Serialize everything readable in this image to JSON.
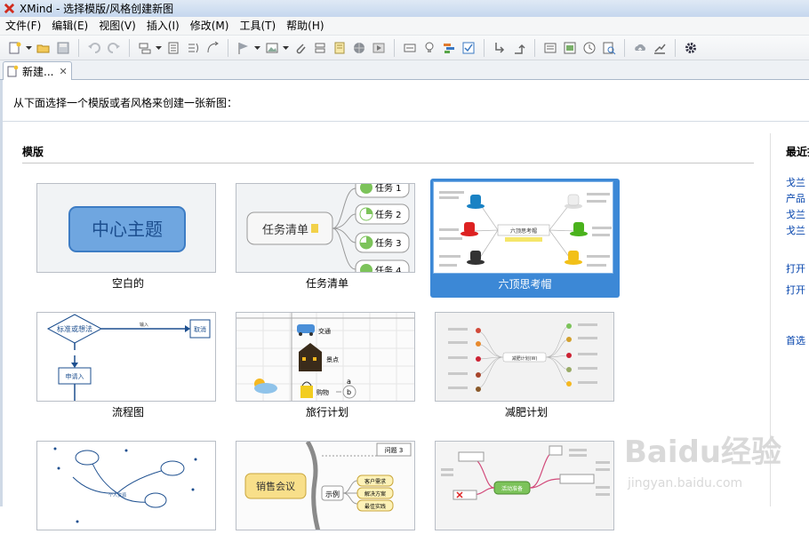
{
  "window": {
    "title": "XMind - 选择模版/风格创建新图"
  },
  "menu": [
    "文件(F)",
    "编辑(E)",
    "视图(V)",
    "插入(I)",
    "修改(M)",
    "工具(T)",
    "帮助(H)"
  ],
  "tab": {
    "label": "新建...",
    "close": "✕"
  },
  "intro": "从下面选择一个模版或者风格来创建一张新图：",
  "templates_title": "模版",
  "recent_title": "最近打",
  "recent_links": [
    "戈兰",
    "产品",
    "戈兰",
    "戈兰"
  ],
  "open_links": [
    "打开",
    "打开"
  ],
  "prefs_link": "首选",
  "templates": [
    {
      "caption": "空白的",
      "thumb_text": "中心主题"
    },
    {
      "caption": "任务清单",
      "thumb_text": "任务清单",
      "tasks": [
        "任务 1",
        "任务 2",
        "任务 3",
        "任务 4"
      ]
    },
    {
      "caption": "六顶思考帽",
      "selected": true,
      "thumb_text": "六顶思考帽"
    },
    {
      "caption": "流程图",
      "nodes": [
        "标准或想法",
        "输入",
        "取消",
        "申请入"
      ]
    },
    {
      "caption": "旅行计划",
      "items": [
        "交通",
        "景点",
        "购物",
        "a",
        "b"
      ]
    },
    {
      "caption": "减肥计划",
      "center": "减肥计划(W)"
    },
    {
      "caption": "",
      "node": "个人资源"
    },
    {
      "caption": "",
      "center": "销售会议",
      "sub": "示例",
      "items": [
        "客户需求",
        "解决方案",
        "最佳实践"
      ],
      "issue": "问题 3"
    },
    {
      "caption": "",
      "center": "活动准备"
    }
  ],
  "watermark": {
    "brand": "Baidu经验",
    "url": "jingyan.baidu.com"
  },
  "colors": {
    "accent": "#3c88d6",
    "link": "#0645ad"
  }
}
